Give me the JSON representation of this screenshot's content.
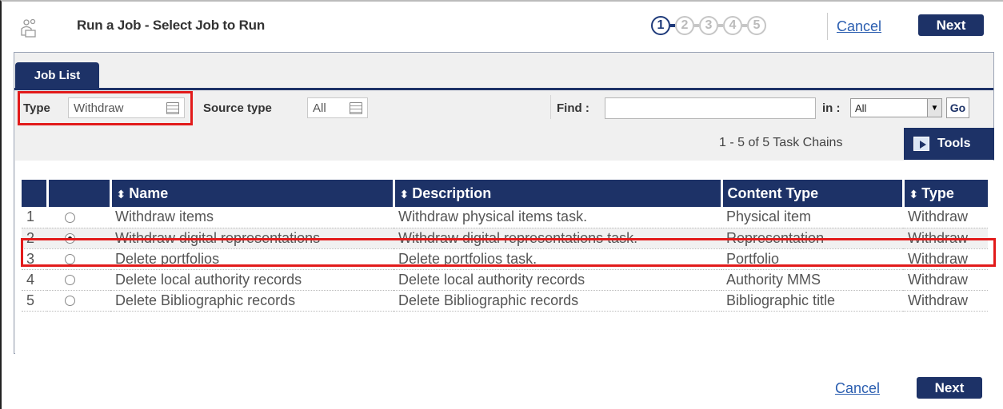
{
  "header": {
    "icon": "job-people-icon",
    "title": "Run a Job - Select Job to Run",
    "steps": [
      "1",
      "2",
      "3",
      "4",
      "5"
    ],
    "active_step": 1,
    "cancel_label": "Cancel",
    "next_label": "Next"
  },
  "panel": {
    "tab_label": "Job List",
    "filters": {
      "type_label": "Type",
      "type_value": "Withdraw",
      "source_type_label": "Source type",
      "source_type_value": "All",
      "find_label": "Find :",
      "find_value": "",
      "in_label": "in :",
      "in_value": "All",
      "go_label": "Go"
    },
    "count_text": "1 - 5 of 5 Task Chains",
    "tools_label": "Tools"
  },
  "table": {
    "columns": [
      {
        "label": "",
        "sortable": false
      },
      {
        "label": "",
        "sortable": false
      },
      {
        "label": "Name",
        "sortable": true
      },
      {
        "label": "Description",
        "sortable": true
      },
      {
        "label": "Content Type",
        "sortable": false
      },
      {
        "label": "Type",
        "sortable": true
      }
    ],
    "rows": [
      {
        "num": "1",
        "selected": false,
        "name": "Withdraw items",
        "description": "Withdraw physical items task.",
        "content_type": "Physical item",
        "type": "Withdraw"
      },
      {
        "num": "2",
        "selected": true,
        "name": "Withdraw digital representations",
        "description": "Withdraw digital representations task.",
        "content_type": "Representation",
        "type": "Withdraw"
      },
      {
        "num": "3",
        "selected": false,
        "name": "Delete portfolios",
        "description": "Delete portfolios task.",
        "content_type": "Portfolio",
        "type": "Withdraw"
      },
      {
        "num": "4",
        "selected": false,
        "name": "Delete local authority records",
        "description": "Delete local authority records",
        "content_type": "Authority MMS",
        "type": "Withdraw"
      },
      {
        "num": "5",
        "selected": false,
        "name": "Delete Bibliographic records",
        "description": "Delete Bibliographic records",
        "content_type": "Bibliographic title",
        "type": "Withdraw"
      }
    ]
  },
  "footer": {
    "cancel_label": "Cancel",
    "next_label": "Next"
  },
  "colors": {
    "brand_navy": "#1d3267",
    "link_blue": "#2b5eb0",
    "highlight_red": "#e21b1b"
  }
}
